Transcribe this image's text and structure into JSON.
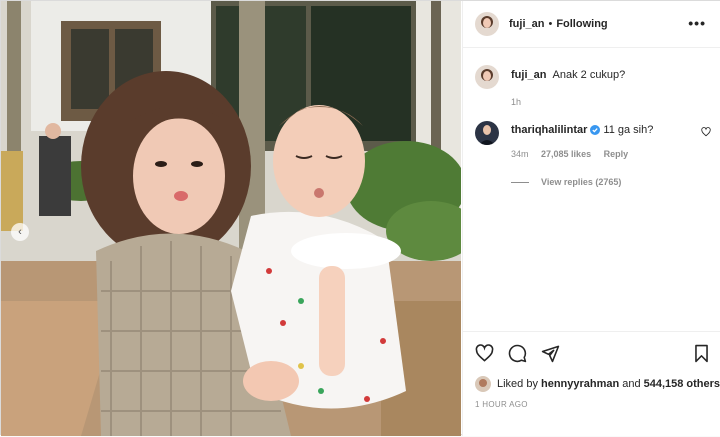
{
  "post": {
    "username": "fuji_an",
    "follow_status": "Following",
    "more_label": "•••"
  },
  "caption": {
    "username": "fuji_an",
    "text": "Anak 2 cukup?",
    "time": "1h"
  },
  "comments": [
    {
      "username": "thariqhalilintar",
      "verified": true,
      "text": "11 ga sih?",
      "time": "34m",
      "likes": "27,085 likes",
      "reply_label": "Reply",
      "view_replies": "View replies (2765)"
    }
  ],
  "likes": {
    "prefix": "Liked by",
    "user": "hennyyrahman",
    "and": "and",
    "count": "544,158 others"
  },
  "timestamp": "1 HOUR AGO",
  "colors": {
    "verified": "#3897f0",
    "text": "#262626",
    "muted": "#8e8e8e"
  },
  "icons": [
    "heart-icon",
    "comment-icon",
    "share-icon",
    "bookmark-icon",
    "more-icon",
    "verified-icon",
    "chevron-left-icon"
  ]
}
